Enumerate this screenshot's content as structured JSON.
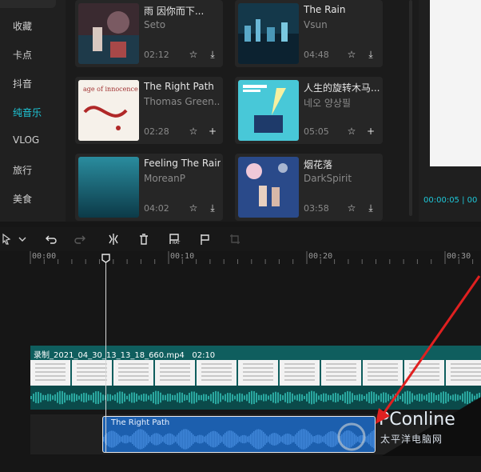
{
  "sidebar": {
    "items": [
      {
        "label": "收藏"
      },
      {
        "label": "卡点"
      },
      {
        "label": "抖音"
      },
      {
        "label": "纯音乐"
      },
      {
        "label": "VLOG"
      },
      {
        "label": "旅行"
      },
      {
        "label": "美食"
      }
    ],
    "active": "纯音乐"
  },
  "music": {
    "cards": [
      {
        "title": "雨 因你而下...",
        "artist": "Seto",
        "duration": "02:12"
      },
      {
        "title": "The Rain",
        "artist": "Vsun",
        "duration": "04:48"
      },
      {
        "title": "The Right Path",
        "artist": "Thomas Green...",
        "duration": "02:28"
      },
      {
        "title": "人生的旋转木马...",
        "artist": "네오 양상필",
        "duration": "05:05"
      },
      {
        "title": "Feeling The Rain",
        "artist": "MoreanP",
        "duration": "04:02"
      },
      {
        "title": "烟花落",
        "artist": "DarkSpirit",
        "duration": "03:58"
      }
    ],
    "thumb3_text": "age of innocence"
  },
  "preview": {
    "time": "00:00:05 | 00"
  },
  "toolbar": {
    "icons": [
      "select-icon",
      "undo-icon",
      "redo-icon",
      "split-icon",
      "delete-icon",
      "freeze-icon",
      "flag-icon",
      "crop-icon"
    ]
  },
  "ruler": {
    "labels": [
      "00:00",
      "00:10",
      "00:20",
      "00:30"
    ]
  },
  "timeline": {
    "video_clip": {
      "name": "录制_2021_04_30_13_13_18_660.mp4",
      "duration": "02:10"
    },
    "audio_clip": {
      "name": "The Right Path"
    }
  },
  "watermark": {
    "brand": "PConline",
    "sub": "太平洋电脑网"
  },
  "colors": {
    "accent": "#1ec7d8",
    "audio_clip": "#1c5fae",
    "video_track": "#0f5e5e",
    "arrow": "#e02020"
  }
}
